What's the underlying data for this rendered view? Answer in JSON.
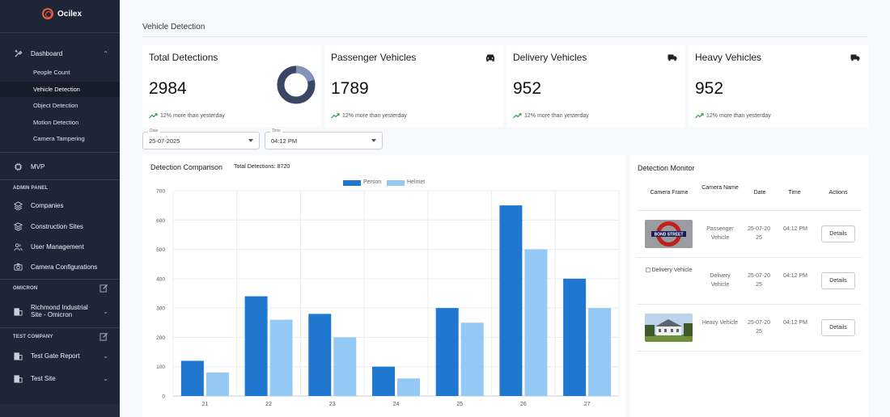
{
  "app": {
    "name": "Ocilex"
  },
  "sidebar": {
    "dashboard": "Dashboard",
    "subitems": [
      "People Count",
      "Vehicle Detection",
      "Object Detection",
      "Motion Detection",
      "Camera Tampering"
    ],
    "mvp": "MVP",
    "admin_header": "ADMIN PANEL",
    "admin_items": [
      "Companies",
      "Construction Sites",
      "User Management",
      "Camera Configurations"
    ],
    "omicron_header": "OMICRON",
    "omicron_site_line1": "Richmond Industrial",
    "omicron_site_line2": "Site - Omicron",
    "test_header": "TEST COMPANY",
    "test_items": [
      "Test Gate Report",
      "Test Site"
    ]
  },
  "page": {
    "title": "Vehicle Detection"
  },
  "cards": [
    {
      "title": "Total Detections",
      "value": "2984",
      "trend": "12% more than yesterday",
      "icon": "donut-chart-icon"
    },
    {
      "title": "Passenger Vehicles",
      "value": "1789",
      "trend": "12% more than yesterday",
      "icon": "car-icon"
    },
    {
      "title": "Delivery Vehicles",
      "value": "952",
      "trend": "12% more than yesterday",
      "icon": "truck-icon"
    },
    {
      "title": "Heavy Vehicles",
      "value": "952",
      "trend": "12% more than yesterday",
      "icon": "truck-icon"
    }
  ],
  "filters": {
    "date_label": "Date",
    "date_value": "25-07-2025",
    "time_label": "Time",
    "time_value": "04:12 PM"
  },
  "chart": {
    "title": "Detection Comparison",
    "total": "Total Detections: 8720"
  },
  "chart_data": {
    "type": "bar",
    "categories": [
      "21",
      "22",
      "23",
      "24",
      "25",
      "26",
      "27"
    ],
    "series": [
      {
        "name": "Person",
        "values": [
          120,
          340,
          280,
          100,
          300,
          650,
          400
        ],
        "color": "#1f77d0"
      },
      {
        "name": "Helmet",
        "values": [
          80,
          260,
          200,
          60,
          250,
          500,
          300
        ],
        "color": "#94c9f5"
      }
    ],
    "ylim": [
      0,
      700
    ],
    "yticks": [
      0,
      100,
      200,
      300,
      400,
      500,
      600,
      700
    ],
    "grid": true,
    "legend": "top-center"
  },
  "monitor": {
    "title": "Detection Monitor",
    "headers": [
      "Camera Frame",
      "Camera Name",
      "Date",
      "Time",
      "Actions"
    ],
    "rows": [
      {
        "frame": "bond-street-sign-image",
        "frame_alt": "",
        "name": "Passenger Vehicle",
        "date": "25-07-2025",
        "time": "04:12 PM",
        "action": "Details"
      },
      {
        "frame": "broken-image",
        "frame_alt": "Delivery Vehicle",
        "name": "Delivery Vehicle",
        "date": "25-07-2025",
        "time": "04:12 PM",
        "action": "Details"
      },
      {
        "frame": "house-image",
        "frame_alt": "",
        "name": "Heavy Vehicle",
        "date": "25-07-2025",
        "time": "04:12 PM",
        "action": "Details"
      }
    ],
    "sign_text": "BOND STREET"
  }
}
